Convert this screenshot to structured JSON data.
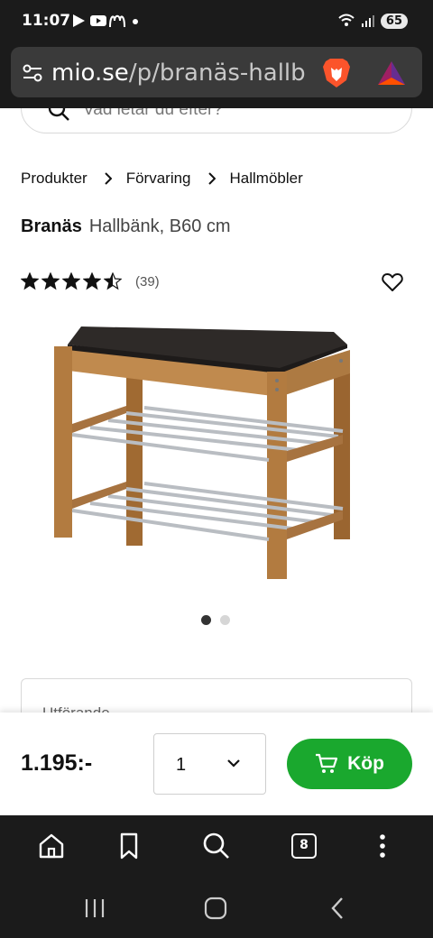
{
  "status_bar": {
    "time": "11:07",
    "battery": "65",
    "icons": [
      "play-icon",
      "youtube-icon",
      "mcdonalds-icon",
      "dot-icon",
      "wifi-icon",
      "signal-icon"
    ]
  },
  "browser": {
    "url_host": "mio.se",
    "url_path": "/p/branäs-hallb",
    "site_settings_icon": "tune-icon",
    "brave_icon": "brave-lion-icon",
    "rewards_icon": "bat-triangle-icon",
    "toolbar": {
      "tab_count": "8",
      "icons": [
        "home-icon",
        "bookmark-icon",
        "search-icon",
        "tabs-icon",
        "more-icon"
      ]
    }
  },
  "search": {
    "placeholder": "Vad letar du efter?"
  },
  "breadcrumb": [
    "Produkter",
    "Förvaring",
    "Hallmöbler"
  ],
  "product": {
    "brand": "Branäs",
    "subtitle": "Hallbänk, B60 cm",
    "rating": 4.5,
    "rating_max": 5,
    "review_count": "(39)",
    "image_index": 1,
    "image_count": 2
  },
  "variant": {
    "label": "Utförande"
  },
  "buy": {
    "price": "1.195:-",
    "quantity": "1",
    "button_label": "Köp"
  },
  "colors": {
    "accent_green": "#1aa82e",
    "dark_bar": "#1b1b1b",
    "url_bar": "#3a3a3a"
  }
}
